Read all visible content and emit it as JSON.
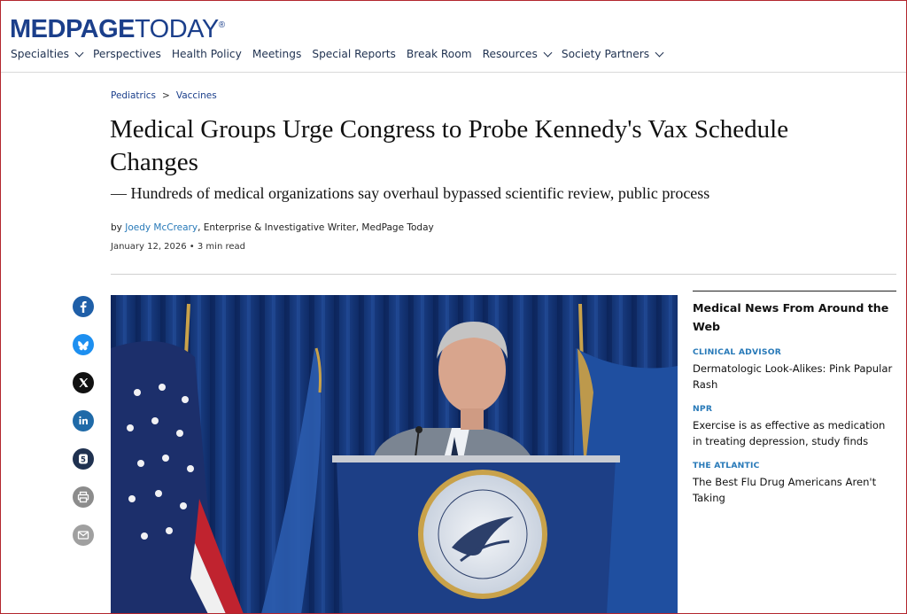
{
  "header": {
    "logo": {
      "part1": "MEDPAGE",
      "part2": "TODAY",
      "mark": "®"
    },
    "nav": [
      {
        "label": "Specialties",
        "dropdown": true
      },
      {
        "label": "Perspectives",
        "dropdown": false
      },
      {
        "label": "Health Policy",
        "dropdown": false
      },
      {
        "label": "Meetings",
        "dropdown": false
      },
      {
        "label": "Special Reports",
        "dropdown": false
      },
      {
        "label": "Break Room",
        "dropdown": false
      },
      {
        "label": "Resources",
        "dropdown": true
      },
      {
        "label": "Society Partners",
        "dropdown": true
      }
    ]
  },
  "article": {
    "breadcrumb": [
      "Pediatrics",
      "Vaccines"
    ],
    "breadcrumb_sep": ">",
    "title": "Medical Groups Urge Congress to Probe Kennedy's Vax Schedule Changes",
    "subtitle": "— Hundreds of medical organizations say overhaul bypassed scientific review, public process",
    "byline_prefix": "by ",
    "author": "Joedy McCreary",
    "author_role": ", Enterprise & Investigative Writer, MedPage Today",
    "date": "January 12, 2026",
    "read_time": " • 3 min read"
  },
  "share": {
    "icons": [
      "facebook-icon",
      "bluesky-icon",
      "x-icon",
      "linkedin-icon",
      "threads-icon",
      "print-icon",
      "email-icon"
    ],
    "threads_count": "5",
    "colors": {
      "facebook": "#1f5fa8",
      "bluesky": "#1d8ff0",
      "x": "#111111",
      "linkedin": "#1f6aa8",
      "threads": "#1f3150",
      "print": "#8c8c8c",
      "email": "#a0a0a0"
    }
  },
  "sidebar": {
    "title": "Medical News From Around the Web",
    "items": [
      {
        "source": "CLINICAL ADVISOR",
        "headline": "Dermatologic Look-Alikes: Pink Papular Rash"
      },
      {
        "source": "NPR",
        "headline": "Exercise is as effective as medication in treating depression, study finds"
      },
      {
        "source": "THE ATLANTIC",
        "headline": "The Best Flu Drug Americans Aren't Taking"
      }
    ]
  },
  "hero": {
    "seal_text": "DEPARTMENT OF HEALTH & HUMAN SERVICES • USA"
  },
  "colors": {
    "brand": "#1b3f8b",
    "link": "#2779b8",
    "frame": "#b3262d"
  }
}
